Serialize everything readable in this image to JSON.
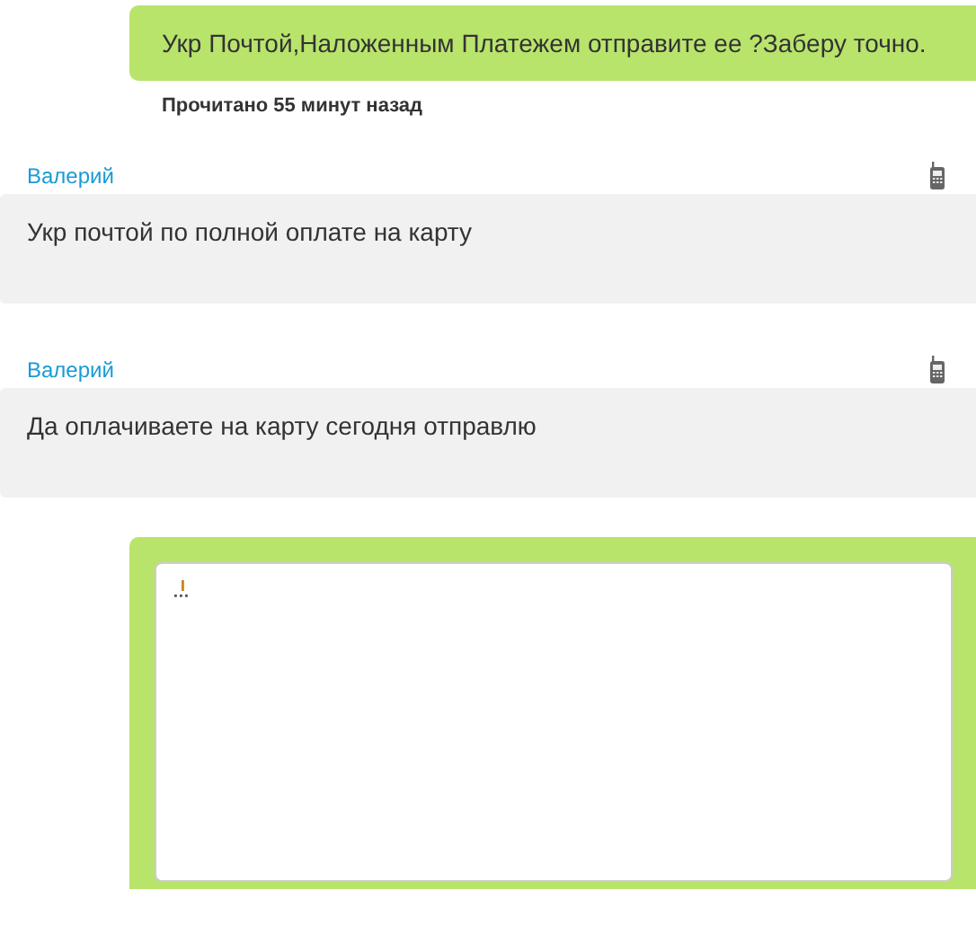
{
  "outgoing": {
    "text": "Укр Почтой,Наложенным Платежем отправите ее ?Заберу точно.",
    "status": "Прочитано 55 минут назад"
  },
  "messages": [
    {
      "author": "Валерий",
      "text": "Укр почтой по полной оплате на карту"
    },
    {
      "author": "Валерий",
      "text": "Да оплачиваете на карту сегодня отправлю"
    }
  ],
  "reply": {
    "kind": "editor"
  }
}
